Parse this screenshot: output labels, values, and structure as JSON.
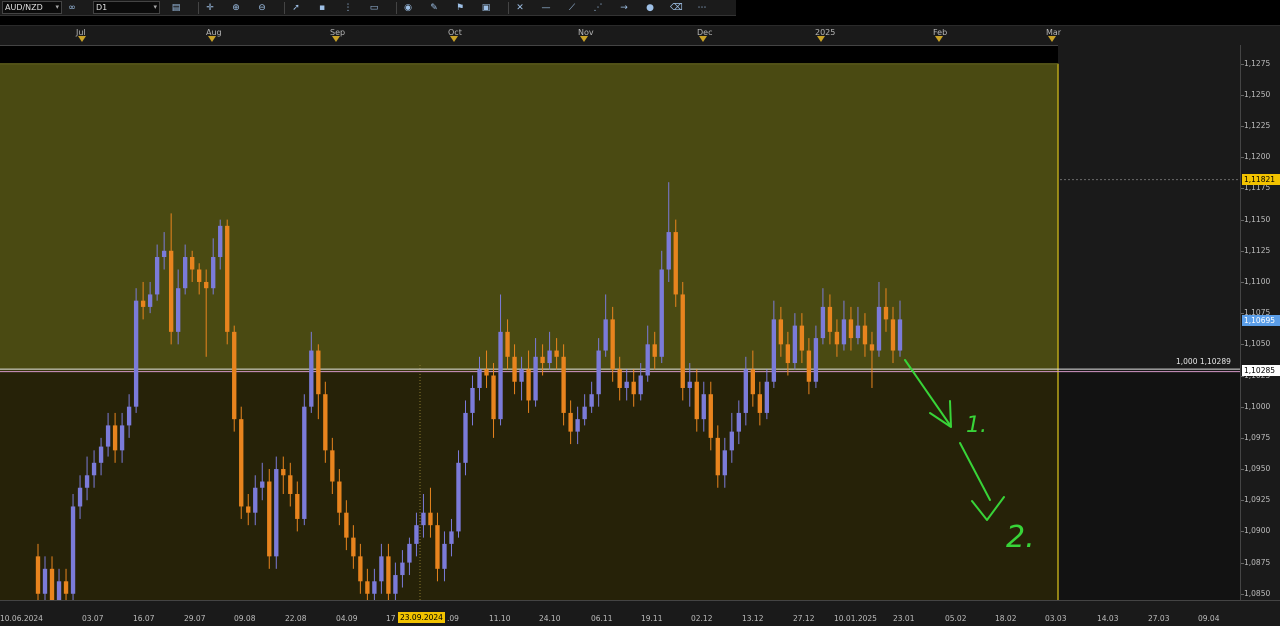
{
  "toolbar": {
    "symbol": "AUD/NZD",
    "timeframe": "D1",
    "icons": [
      "chart-type-icon",
      "crosshair-icon",
      "zoom-in-icon",
      "zoom-out-icon",
      "cursor-icon",
      "point-icon",
      "vertical-line-icon",
      "text-icon",
      "camera-icon",
      "pencil-icon",
      "flag-icon",
      "image-icon",
      "cross-icon",
      "horizontal-line-icon",
      "trend-line-icon",
      "channel-icon",
      "arrow-icon",
      "circle-icon",
      "eraser-icon",
      "more-icon"
    ]
  },
  "months": [
    {
      "label": "Jul",
      "pos": 82
    },
    {
      "label": "Aug",
      "pos": 212
    },
    {
      "label": "Sep",
      "pos": 336
    },
    {
      "label": "Oct",
      "pos": 454
    },
    {
      "label": "Nov",
      "pos": 584
    },
    {
      "label": "Dec",
      "pos": 703
    },
    {
      "label": "2025",
      "pos": 821
    },
    {
      "label": "Feb",
      "pos": 939
    },
    {
      "label": "Mar",
      "pos": 1052
    }
  ],
  "price_labels": [
    "1,1275",
    "1,1250",
    "1,1225",
    "1,1200",
    "1,1175",
    "1,1150",
    "1,1125",
    "1,1100",
    "1,1075",
    "1,1050",
    "1,1025",
    "1,1000",
    "1,0975",
    "1,0950",
    "1,0925",
    "1,0900",
    "1,0875",
    "1,0850"
  ],
  "price_badges": {
    "high_line": {
      "value": "1,11821",
      "color": "#f2c200"
    },
    "current": {
      "value": "1,10695",
      "color": "#5b9ee8"
    },
    "fib_level": {
      "value": "1,10285",
      "color": "#ffffff"
    }
  },
  "fib_label": "1,000 1,10289",
  "dates": [
    "10.06.2024",
    "03.07",
    "16.07",
    "29.07",
    "09.08",
    "22.08",
    "04.09",
    "17",
    "23.09.2024",
    ".09",
    "11.10",
    "24.10",
    "06.11",
    "19.11",
    "02.12",
    "13.12",
    "27.12",
    "10.01.2025",
    "23.01",
    "05.02",
    "18.02",
    "03.03",
    "14.03",
    "27.03",
    "09.04"
  ],
  "annotations": [
    "1.",
    "2."
  ],
  "chart_data": {
    "type": "candlestick",
    "symbol": "AUD/NZD",
    "timeframe": "D1",
    "ylim": [
      1.0845,
      1.129
    ],
    "up_color": "#7b7bd9",
    "down_color": "#e8841e",
    "levels": {
      "upper_zone_top": 1.1275,
      "fib_1_000": 1.10289,
      "high_line": 1.11821,
      "current": 1.10695
    },
    "candles": [
      [
        1.088,
        1.085,
        1.089,
        1.083
      ],
      [
        1.085,
        1.087,
        1.088,
        1.084
      ],
      [
        1.087,
        1.0845,
        1.088,
        1.0835
      ],
      [
        1.0845,
        1.086,
        1.087,
        1.084
      ],
      [
        1.086,
        1.085,
        1.087,
        1.084
      ],
      [
        1.085,
        1.092,
        1.093,
        1.0845
      ],
      [
        1.092,
        1.0935,
        1.0945,
        1.091
      ],
      [
        1.0935,
        1.0945,
        1.096,
        1.0925
      ],
      [
        1.0945,
        1.0955,
        1.0965,
        1.0935
      ],
      [
        1.0955,
        1.0968,
        1.0975,
        1.0945
      ],
      [
        1.0968,
        1.0985,
        1.0995,
        1.096
      ],
      [
        1.0985,
        1.0965,
        1.0995,
        1.0955
      ],
      [
        1.0965,
        1.0985,
        1.0995,
        1.0955
      ],
      [
        1.0985,
        1.1,
        1.101,
        1.0975
      ],
      [
        1.1,
        1.1085,
        1.1095,
        1.0995
      ],
      [
        1.1085,
        1.108,
        1.11,
        1.107
      ],
      [
        1.108,
        1.109,
        1.11,
        1.1075
      ],
      [
        1.109,
        1.112,
        1.113,
        1.1085
      ],
      [
        1.112,
        1.1125,
        1.114,
        1.111
      ],
      [
        1.1125,
        1.106,
        1.1155,
        1.105
      ],
      [
        1.106,
        1.1095,
        1.111,
        1.105
      ],
      [
        1.1095,
        1.112,
        1.113,
        1.109
      ],
      [
        1.112,
        1.111,
        1.1125,
        1.11
      ],
      [
        1.111,
        1.11,
        1.1115,
        1.109
      ],
      [
        1.11,
        1.1095,
        1.111,
        1.104
      ],
      [
        1.1095,
        1.112,
        1.1135,
        1.109
      ],
      [
        1.112,
        1.1145,
        1.115,
        1.111
      ],
      [
        1.1145,
        1.106,
        1.115,
        1.105
      ],
      [
        1.106,
        1.099,
        1.1065,
        1.098
      ],
      [
        1.099,
        1.092,
        1.1,
        1.091
      ],
      [
        1.092,
        1.0915,
        1.093,
        1.0905
      ],
      [
        1.0915,
        1.0935,
        1.0945,
        1.0905
      ],
      [
        1.0935,
        1.094,
        1.0955,
        1.0925
      ],
      [
        1.094,
        1.088,
        1.095,
        1.087
      ],
      [
        1.088,
        1.095,
        1.096,
        1.087
      ],
      [
        1.095,
        1.0945,
        1.096,
        1.093
      ],
      [
        1.0945,
        1.093,
        1.0955,
        1.092
      ],
      [
        1.093,
        1.091,
        1.094,
        1.09
      ],
      [
        1.091,
        1.1,
        1.101,
        1.0905
      ],
      [
        1.1,
        1.1045,
        1.106,
        1.0995
      ],
      [
        1.1045,
        1.101,
        1.105,
        1.099
      ],
      [
        1.101,
        1.0965,
        1.102,
        1.0955
      ],
      [
        1.0965,
        1.094,
        1.0975,
        1.093
      ],
      [
        1.094,
        1.0915,
        1.095,
        1.0905
      ],
      [
        1.0915,
        1.0895,
        1.0925,
        1.0885
      ],
      [
        1.0895,
        1.088,
        1.0905,
        1.087
      ],
      [
        1.088,
        1.086,
        1.089,
        1.085
      ],
      [
        1.086,
        1.085,
        1.087,
        1.084
      ],
      [
        1.085,
        1.086,
        1.087,
        1.084
      ],
      [
        1.086,
        1.088,
        1.089,
        1.085
      ],
      [
        1.088,
        1.085,
        1.089,
        1.084
      ],
      [
        1.085,
        1.0865,
        1.0875,
        1.084
      ],
      [
        1.0865,
        1.0875,
        1.0885,
        1.0855
      ],
      [
        1.0875,
        1.089,
        1.0895,
        1.0865
      ],
      [
        1.089,
        1.0905,
        1.0915,
        1.088
      ],
      [
        1.0905,
        1.0915,
        1.093,
        1.0895
      ],
      [
        1.0915,
        1.0905,
        1.0935,
        1.0895
      ],
      [
        1.0905,
        1.087,
        1.0915,
        1.086
      ],
      [
        1.087,
        1.089,
        1.09,
        1.086
      ],
      [
        1.089,
        1.09,
        1.091,
        1.088
      ],
      [
        1.09,
        1.0955,
        1.0965,
        1.0895
      ],
      [
        1.0955,
        1.0995,
        1.1005,
        1.0945
      ],
      [
        1.0995,
        1.1015,
        1.1025,
        1.0985
      ],
      [
        1.1015,
        1.103,
        1.104,
        1.1005
      ],
      [
        1.103,
        1.1025,
        1.1045,
        1.1015
      ],
      [
        1.1025,
        1.099,
        1.1035,
        1.0975
      ],
      [
        1.099,
        1.106,
        1.109,
        1.0985
      ],
      [
        1.106,
        1.104,
        1.107,
        1.103
      ],
      [
        1.104,
        1.102,
        1.105,
        1.101
      ],
      [
        1.102,
        1.103,
        1.104,
        1.1005
      ],
      [
        1.103,
        1.1005,
        1.1045,
        1.0995
      ],
      [
        1.1005,
        1.104,
        1.1055,
        1.1
      ],
      [
        1.104,
        1.1035,
        1.105,
        1.1025
      ],
      [
        1.1035,
        1.1045,
        1.106,
        1.103
      ],
      [
        1.1045,
        1.104,
        1.1055,
        1.103
      ],
      [
        1.104,
        1.0995,
        1.105,
        1.0985
      ],
      [
        1.0995,
        1.098,
        1.1005,
        1.097
      ],
      [
        1.098,
        1.099,
        1.1,
        1.097
      ],
      [
        1.099,
        1.1,
        1.101,
        1.0985
      ],
      [
        1.1,
        1.101,
        1.102,
        1.0995
      ],
      [
        1.101,
        1.1045,
        1.1055,
        1.1
      ],
      [
        1.1045,
        1.107,
        1.109,
        1.104
      ],
      [
        1.107,
        1.103,
        1.108,
        1.102
      ],
      [
        1.103,
        1.1015,
        1.104,
        1.1005
      ],
      [
        1.1015,
        1.102,
        1.103,
        1.1005
      ],
      [
        1.102,
        1.101,
        1.103,
        1.1
      ],
      [
        1.101,
        1.1025,
        1.1035,
        1.1005
      ],
      [
        1.1025,
        1.105,
        1.1065,
        1.102
      ],
      [
        1.105,
        1.104,
        1.106,
        1.103
      ],
      [
        1.104,
        1.111,
        1.1125,
        1.1035
      ],
      [
        1.111,
        1.114,
        1.118,
        1.11
      ],
      [
        1.114,
        1.109,
        1.115,
        1.108
      ],
      [
        1.109,
        1.1015,
        1.11,
        1.1005
      ],
      [
        1.1015,
        1.102,
        1.1035,
        1.1
      ],
      [
        1.102,
        1.099,
        1.103,
        1.098
      ],
      [
        1.099,
        1.101,
        1.102,
        1.098
      ],
      [
        1.101,
        1.0975,
        1.102,
        1.0965
      ],
      [
        1.0975,
        1.0945,
        1.0985,
        1.0935
      ],
      [
        1.0945,
        1.0965,
        1.0975,
        1.0935
      ],
      [
        1.0965,
        1.098,
        1.0995,
        1.0955
      ],
      [
        1.098,
        1.0995,
        1.1005,
        1.097
      ],
      [
        1.0995,
        1.103,
        1.104,
        1.0985
      ],
      [
        1.103,
        1.101,
        1.1045,
        1.1
      ],
      [
        1.101,
        1.0995,
        1.102,
        1.0985
      ],
      [
        1.0995,
        1.102,
        1.103,
        1.099
      ],
      [
        1.102,
        1.107,
        1.1085,
        1.1015
      ],
      [
        1.107,
        1.105,
        1.108,
        1.104
      ],
      [
        1.105,
        1.1035,
        1.106,
        1.1025
      ],
      [
        1.1035,
        1.1065,
        1.1075,
        1.103
      ],
      [
        1.1065,
        1.1045,
        1.1075,
        1.1035
      ],
      [
        1.1045,
        1.102,
        1.1055,
        1.101
      ],
      [
        1.102,
        1.1055,
        1.1065,
        1.1015
      ],
      [
        1.1055,
        1.108,
        1.1095,
        1.105
      ],
      [
        1.108,
        1.106,
        1.109,
        1.105
      ],
      [
        1.106,
        1.105,
        1.107,
        1.104
      ],
      [
        1.105,
        1.107,
        1.1085,
        1.1045
      ],
      [
        1.107,
        1.1055,
        1.108,
        1.1045
      ],
      [
        1.1055,
        1.1065,
        1.108,
        1.105
      ],
      [
        1.1065,
        1.105,
        1.1075,
        1.104
      ],
      [
        1.105,
        1.1045,
        1.106,
        1.1015
      ],
      [
        1.1045,
        1.108,
        1.11,
        1.104
      ],
      [
        1.108,
        1.107,
        1.1095,
        1.106
      ],
      [
        1.107,
        1.1045,
        1.108,
        1.1035
      ],
      [
        1.1045,
        1.107,
        1.1085,
        1.104
      ]
    ]
  }
}
